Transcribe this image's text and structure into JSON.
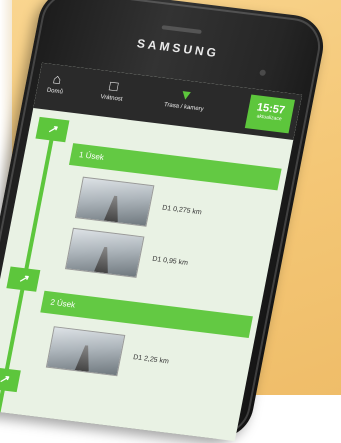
{
  "device": {
    "brand": "SAMSUNG"
  },
  "app": {
    "nav": [
      {
        "icon": "home-icon",
        "label": "Domů"
      },
      {
        "icon": "book-icon",
        "label": "Vrátnost"
      },
      {
        "icon": "pin-icon",
        "label": "Trasa / kamery"
      }
    ],
    "clock": {
      "time": "15:57",
      "sub": "aktualizace"
    }
  },
  "route": [
    {
      "marker": "↗",
      "title": "1 Úsek",
      "cameras": [
        {
          "distance": "D1 0,275 km"
        },
        {
          "distance": "D1 0,95 km"
        }
      ]
    },
    {
      "marker": "↗",
      "title": "2 Úsek",
      "cameras": [
        {
          "distance": "D1 2,25 km"
        }
      ]
    },
    {
      "marker": "↗"
    }
  ],
  "colors": {
    "accent": "#5dc63c",
    "phone": "#1f1f1f",
    "background": "#f4c776"
  }
}
